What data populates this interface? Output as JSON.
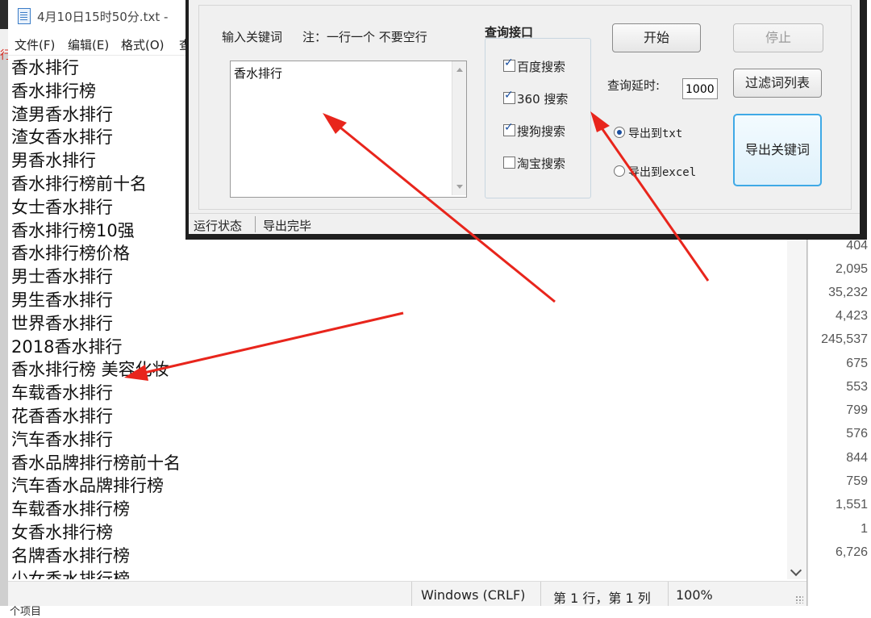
{
  "notepad": {
    "title": "4月10日15时50分.txt -",
    "menu": [
      "文件(F)",
      "编辑(E)",
      "格式(O)",
      "查"
    ],
    "lines": [
      "香水排行",
      "香水排行榜",
      "渣男香水排行",
      "渣女香水排行",
      "男香水排行",
      "香水排行榜前十名",
      "女士香水排行",
      "香水排行榜10强",
      "香水排行榜价格",
      "男士香水排行",
      "男生香水排行",
      "世界香水排行",
      "2018香水排行",
      "香水排行榜 美容化妆",
      "车载香水排行",
      "花香香水排行",
      "汽车香水排行",
      "香水品牌排行榜前十名",
      "汽车香水品牌排行榜",
      "车载香水排行榜",
      "女香水排行榜",
      "名牌香水排行榜",
      "少女香水排行榜"
    ],
    "status": {
      "line_ending": "Windows (CRLF)",
      "position": "第 1 行，第 1 列",
      "zoom": "100%"
    }
  },
  "background_numbers": [
    "404",
    "2,095",
    "35,232",
    "4,423",
    "245,537",
    "675",
    "553",
    "799",
    "576",
    "844",
    "759",
    "1,551",
    "1",
    "6,726"
  ],
  "bottom_partial_text": "个项目",
  "tool": {
    "keyword_label": "输入关键词",
    "note_label": "注：一行一个 不要空行",
    "keyword_text": "香水排行",
    "interface_label": "查询接口",
    "interfaces": [
      {
        "label": "百度搜索",
        "checked": true
      },
      {
        "label": "360 搜索",
        "checked": true
      },
      {
        "label": "搜狗搜索",
        "checked": true
      },
      {
        "label": "淘宝搜索",
        "checked": false
      }
    ],
    "start_button": "开始",
    "stop_button": "停止",
    "delay_label": "查询延时:",
    "delay_value": "1000",
    "filter_button": "过滤词列表",
    "export_txt": "导出到txt",
    "export_excel": "导出到excel",
    "export_button": "导出关键词",
    "status_label": "运行状态",
    "status_value": "导出完毕"
  },
  "colors": {
    "arrow": "#e8251c",
    "export_border": "#3fa9e6",
    "tool_frame": "#1f1f1f"
  }
}
